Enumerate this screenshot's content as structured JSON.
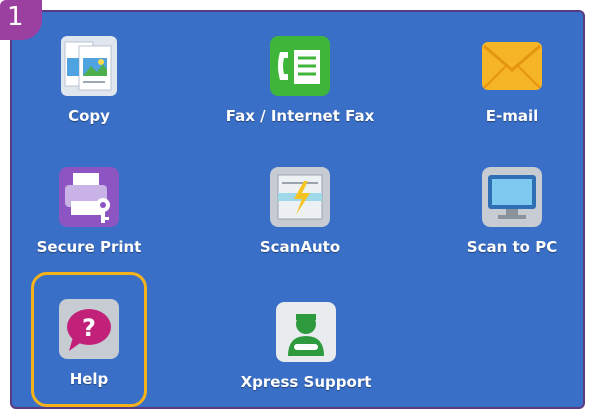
{
  "step_badge": "1",
  "tiles": [
    {
      "label": "Copy",
      "icon": "copy-icon"
    },
    {
      "label": "Fax / Internet Fax",
      "icon": "fax-icon"
    },
    {
      "label": "E-mail",
      "icon": "email-icon"
    },
    {
      "label": "Secure Print",
      "icon": "secure-print-icon"
    },
    {
      "label": "ScanAuto",
      "icon": "scanauto-icon"
    },
    {
      "label": "Scan to PC",
      "icon": "scan-to-pc-icon"
    },
    {
      "label": "Help",
      "icon": "help-icon"
    },
    {
      "label": "Xpress Support",
      "icon": "xpress-support-icon"
    }
  ],
  "colors": {
    "screen_bg": "#3a6fc7",
    "frame": "#5a3a82",
    "badge": "#9b3fa0",
    "highlight": "#f5b21b"
  }
}
